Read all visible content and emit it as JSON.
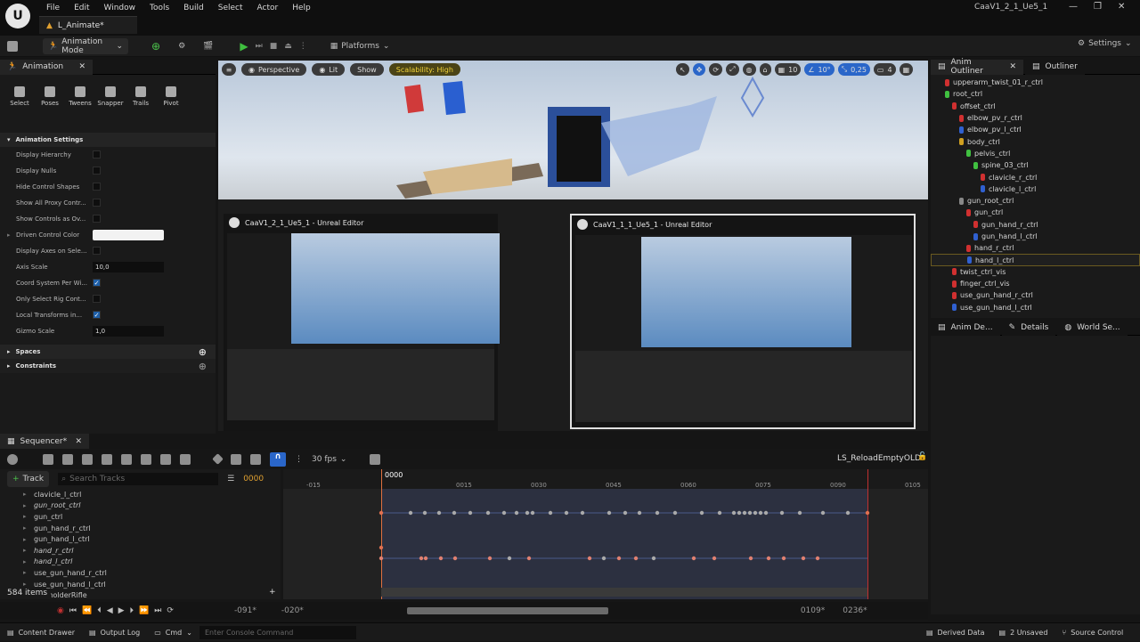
{
  "menu": [
    "File",
    "Edit",
    "Window",
    "Tools",
    "Build",
    "Select",
    "Actor",
    "Help"
  ],
  "doc_tab": "L_Animate*",
  "project_name": "CaaV1_2_1_Ue5_1",
  "toolbar": {
    "mode": "Animation Mode",
    "platforms": "Platforms",
    "settings": "Settings"
  },
  "anim_panel": {
    "tab": "Animation",
    "tools": [
      "Select",
      "Poses",
      "Tweens",
      "Snapper",
      "Trails",
      "Pivot"
    ],
    "section": "Animation Settings",
    "props": {
      "display_hierarchy": "Display Hierarchy",
      "display_nulls": "Display Nulls",
      "hide_control_shapes": "Hide Control Shapes",
      "show_all_proxy": "Show All Proxy Contr...",
      "show_controls_as": "Show Controls as Ov...",
      "driven_control_color": "Driven Control Color",
      "display_axes": "Display Axes on Sele...",
      "axis_scale": "Axis Scale",
      "axis_scale_value": "10,0",
      "coord_system": "Coord System Per Wi...",
      "only_select_rig": "Only Select Rig Cont...",
      "local_transforms": "Local Transforms in...",
      "gizmo_scale": "Gizmo Scale",
      "gizmo_scale_value": "1,0"
    },
    "spaces": "Spaces",
    "constraints": "Constraints"
  },
  "viewport": {
    "perspective": "Perspective",
    "lit": "Lit",
    "show": "Show",
    "scalability": "Scalability: High",
    "grid": "10",
    "angle": "10°",
    "scale": "0,25",
    "cam": "4"
  },
  "thumbs": {
    "left_title": "CaaV1_2_1_Ue5_1 - Unreal Editor",
    "right_title": "CaaV1_1_1_Ue5_1 - Unreal Editor"
  },
  "outliner": {
    "tab1": "Anim Outliner",
    "tab2": "Outliner",
    "items": [
      {
        "label": "upperarm_twist_01_r_ctrl",
        "indent": 1,
        "color": "#d03030"
      },
      {
        "label": "root_ctrl",
        "indent": 1,
        "color": "#40c040"
      },
      {
        "label": "offset_ctrl",
        "indent": 2,
        "color": "#d03030"
      },
      {
        "label": "elbow_pv_r_ctrl",
        "indent": 3,
        "color": "#d03030"
      },
      {
        "label": "elbow_pv_l_ctrl",
        "indent": 3,
        "color": "#3060d0"
      },
      {
        "label": "body_ctrl",
        "indent": 3,
        "color": "#d0a020"
      },
      {
        "label": "pelvis_ctrl",
        "indent": 4,
        "color": "#40c040"
      },
      {
        "label": "spine_03_ctrl",
        "indent": 5,
        "color": "#40c040"
      },
      {
        "label": "clavicle_r_ctrl",
        "indent": 6,
        "color": "#d03030"
      },
      {
        "label": "clavicle_l_ctrl",
        "indent": 6,
        "color": "#3060d0"
      },
      {
        "label": "gun_root_ctrl",
        "indent": 3,
        "color": "#888888"
      },
      {
        "label": "gun_ctrl",
        "indent": 4,
        "color": "#d03030"
      },
      {
        "label": "gun_hand_r_ctrl",
        "indent": 5,
        "color": "#d03030"
      },
      {
        "label": "gun_hand_l_ctrl",
        "indent": 5,
        "color": "#3060d0"
      },
      {
        "label": "hand_r_ctrl",
        "indent": 4,
        "color": "#d03030"
      },
      {
        "label": "hand_l_ctrl",
        "indent": 4,
        "color": "#3060d0"
      },
      {
        "label": "twist_ctrl_vis",
        "indent": 2,
        "color": "#d03030"
      },
      {
        "label": "finger_ctrl_vis",
        "indent": 2,
        "color": "#d03030"
      },
      {
        "label": "use_gun_hand_r_ctrl",
        "indent": 2,
        "color": "#d03030"
      },
      {
        "label": "use_gun_hand_l_ctrl",
        "indent": 2,
        "color": "#3060d0"
      }
    ],
    "tab3": "Anim De...",
    "tab4": "Details",
    "tab5": "World Se..."
  },
  "sequencer": {
    "tab": "Sequencer*",
    "fps": "30 fps",
    "sequence": "LS_ReloadEmptyOLD*",
    "track_btn": "Track",
    "search_placeholder": "Search Tracks",
    "frame": "0000",
    "tracks": [
      "clavicle_l_ctrl",
      "gun_root_ctrl",
      "gun_ctrl",
      "gun_hand_r_ctrl",
      "gun_hand_l_ctrl",
      "hand_r_ctrl",
      "hand_l_ctrl",
      "use_gun_hand_r_ctrl",
      "use_gun_hand_l_ctrl",
      "laceholderRifle"
    ],
    "items_count": "584 items",
    "ruler": [
      "-015",
      "0015",
      "0030",
      "0045",
      "0060",
      "0075",
      "0090",
      "0105"
    ],
    "playhead": "0000",
    "range": {
      "a": "-091*",
      "b": "-020*",
      "c": "0109*",
      "d": "0236*"
    }
  },
  "status": {
    "content_drawer": "Content Drawer",
    "output_log": "Output Log",
    "cmd": "Cmd",
    "console_placeholder": "Enter Console Command",
    "derived": "Derived Data",
    "unsaved": "2 Unsaved",
    "source": "Source Control"
  }
}
